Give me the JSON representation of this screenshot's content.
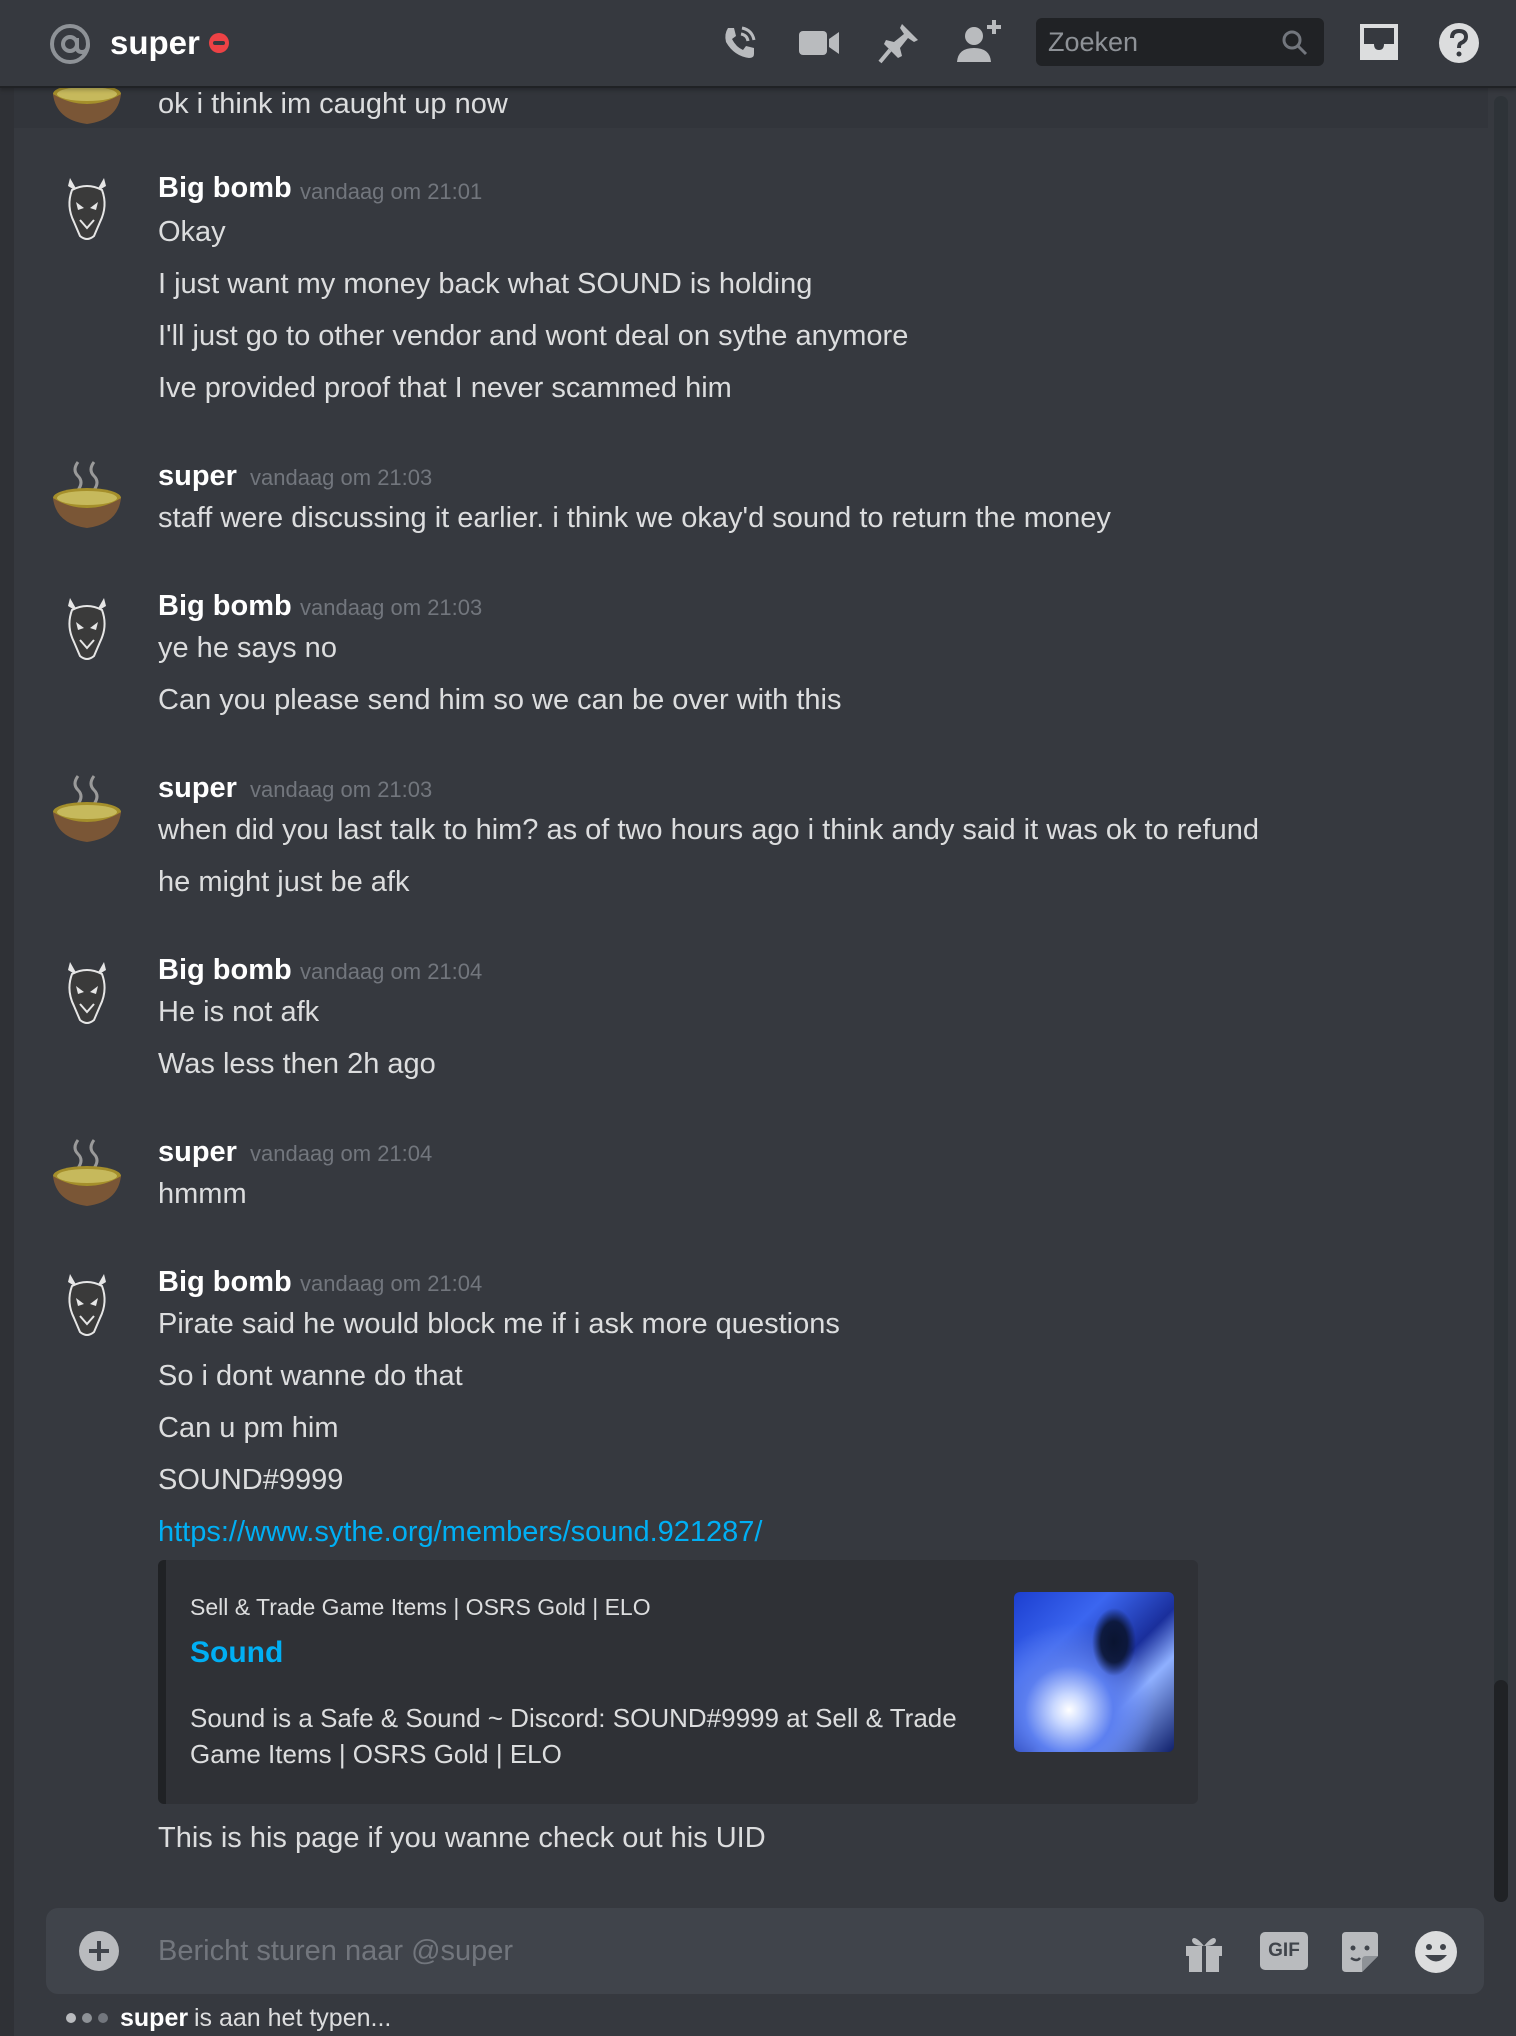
{
  "header": {
    "title": "super",
    "search_placeholder": "Zoeken"
  },
  "messages": {
    "top_line": "ok i think im caught up now",
    "groups": [
      {
        "author": "Big bomb",
        "timestamp": "vandaag om 21:01",
        "lines": [
          "Okay",
          "I just want my money back what SOUND is holding",
          "I'll just go to other vendor and wont deal on sythe anymore",
          "Ive provided proof that I never scammed him"
        ]
      },
      {
        "author": "super",
        "timestamp": "vandaag om 21:03",
        "lines": [
          "staff were discussing it earlier. i think we okay'd sound to return the money"
        ]
      },
      {
        "author": "Big bomb",
        "timestamp": "vandaag om 21:03",
        "lines": [
          "ye he says no",
          "Can you please send him so we can be over with this"
        ]
      },
      {
        "author": "super",
        "timestamp": "vandaag om 21:03",
        "lines": [
          "when did you last talk to him? as of two hours ago i think andy said it was ok to refund",
          "he might just be afk"
        ]
      },
      {
        "author": "Big bomb",
        "timestamp": "vandaag om 21:04",
        "lines": [
          "He is not afk",
          "Was less then 2h ago"
        ]
      },
      {
        "author": "super",
        "timestamp": "vandaag om 21:04",
        "lines": [
          "hmmm"
        ]
      },
      {
        "author": "Big bomb",
        "timestamp": "vandaag om 21:04",
        "lines": [
          "Pirate said he would block me if i ask more questions",
          "So i dont wanne do that",
          "Can u pm him",
          "SOUND#9999"
        ],
        "link": "https://www.sythe.org/members/sound.921287/",
        "after_embed": "This is his page if you wanne check out his UID"
      }
    ]
  },
  "embed": {
    "provider": "Sell & Trade Game Items | OSRS Gold | ELO",
    "title": "Sound",
    "description": "Sound is a Safe & Sound ~ Discord: SOUND#9999 at Sell & Trade Game Items | OSRS Gold | ELO"
  },
  "composer": {
    "placeholder": "Bericht sturen naar @super",
    "gif_label": "GIF"
  },
  "typing": {
    "user": "super",
    "text": "is aan het typen..."
  },
  "colors": {
    "background": "#36393f",
    "link": "#00aff4",
    "dnd": "#ed4245",
    "timestamp": "#72767d"
  },
  "icons": [
    "at-icon",
    "dnd-status-icon",
    "phone-call-icon",
    "video-icon",
    "pin-icon",
    "add-friend-icon",
    "search-icon",
    "inbox-icon",
    "help-icon",
    "plus-icon",
    "gift-icon",
    "gif-icon",
    "sticker-icon",
    "emoji-icon"
  ]
}
